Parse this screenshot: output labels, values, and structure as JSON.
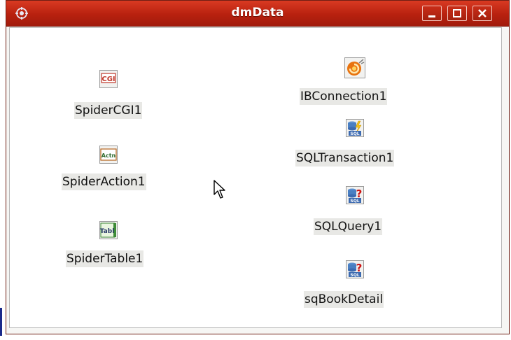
{
  "window": {
    "title": "dmData"
  },
  "components": [
    {
      "name": "SpiderCGI1",
      "icon": "cgi-icon",
      "icon_text": "CGI"
    },
    {
      "name": "SpiderAction1",
      "icon": "action-icon",
      "icon_text": "Actn"
    },
    {
      "name": "SpiderTable1",
      "icon": "table-icon",
      "icon_text": "Tabl"
    },
    {
      "name": "IBConnection1",
      "icon": "firebird-connection-icon"
    },
    {
      "name": "SQLTransaction1",
      "icon": "sql-transaction-icon",
      "icon_text": "SQL"
    },
    {
      "name": "SQLQuery1",
      "icon": "sql-query-icon",
      "icon_text": "SQL"
    },
    {
      "name": "sqBookDetail",
      "icon": "sql-query-icon",
      "icon_text": "SQL"
    }
  ]
}
